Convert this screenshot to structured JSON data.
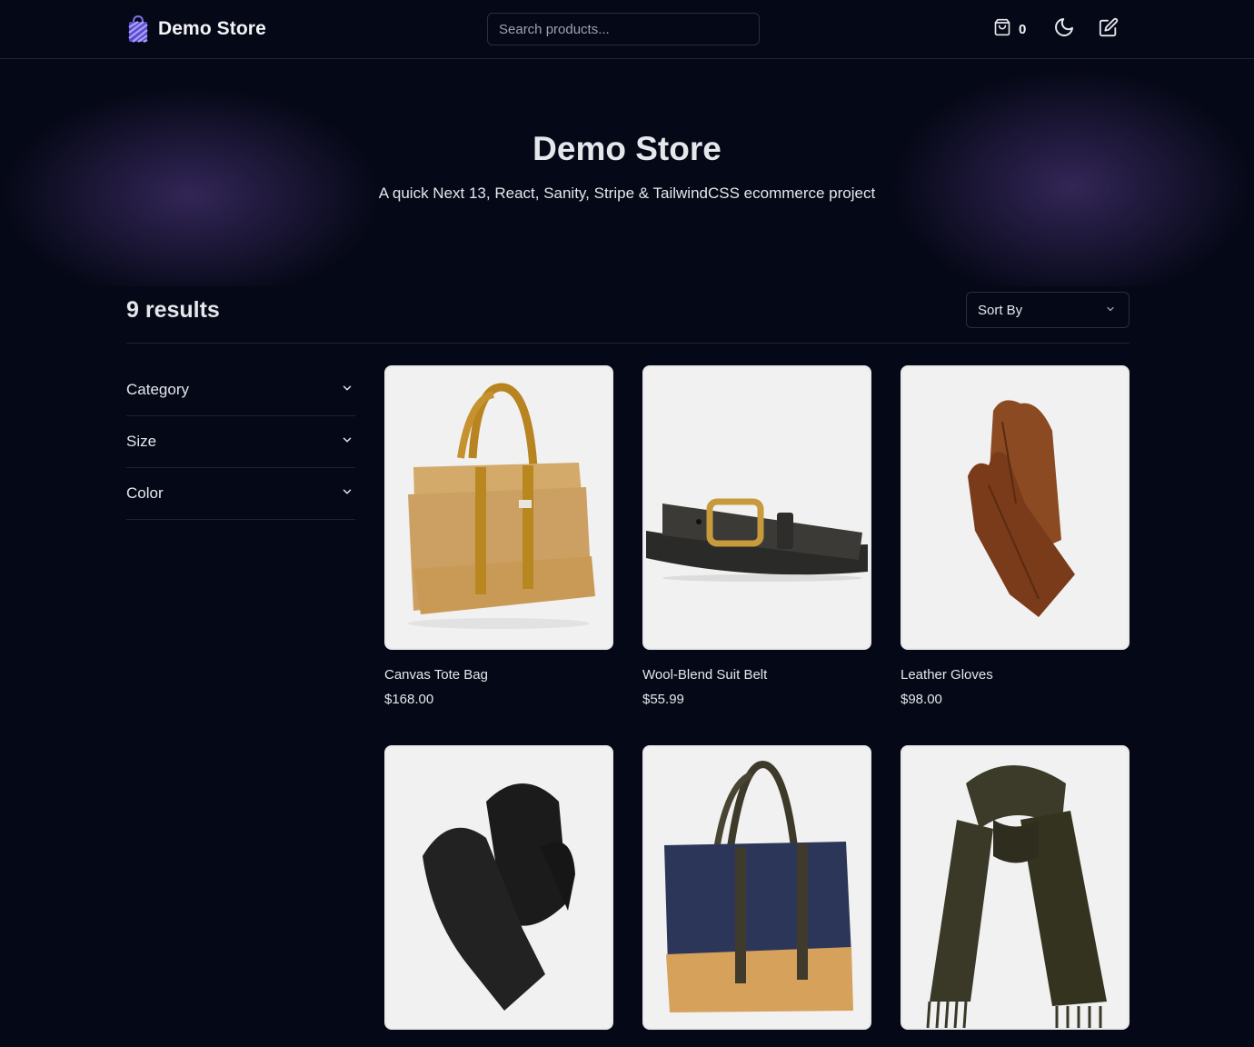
{
  "header": {
    "brand_name": "Demo Store",
    "search_placeholder": "Search products...",
    "cart_count": "0"
  },
  "hero": {
    "title": "Demo Store",
    "subtitle": "A quick Next 13, React, Sanity, Stripe & TailwindCSS ecommerce project"
  },
  "listing": {
    "results_label": "9 results",
    "sort_label": "Sort By"
  },
  "filters": [
    {
      "label": "Category"
    },
    {
      "label": "Size"
    },
    {
      "label": "Color"
    }
  ],
  "products": [
    {
      "name": "Canvas Tote Bag",
      "price": "$168.00",
      "image": "tan-tote-bag"
    },
    {
      "name": "Wool-Blend Suit Belt",
      "price": "$55.99",
      "image": "black-leather-belt"
    },
    {
      "name": "Leather Gloves",
      "price": "$98.00",
      "image": "brown-leather-gloves"
    },
    {
      "name": "",
      "price": "",
      "image": "black-mittens"
    },
    {
      "name": "",
      "price": "",
      "image": "navy-tote-bag"
    },
    {
      "name": "",
      "price": "",
      "image": "olive-fringed-scarf"
    }
  ],
  "icons": {
    "logo": "shopping-bag-icon",
    "cart": "cart-icon",
    "theme": "moon-icon",
    "edit": "edit-icon",
    "chevron": "chevron-down-icon"
  },
  "colors": {
    "background": "#050816",
    "border": "#1f2433",
    "text": "#e5e7eb",
    "accent": "#5b4ad6"
  }
}
